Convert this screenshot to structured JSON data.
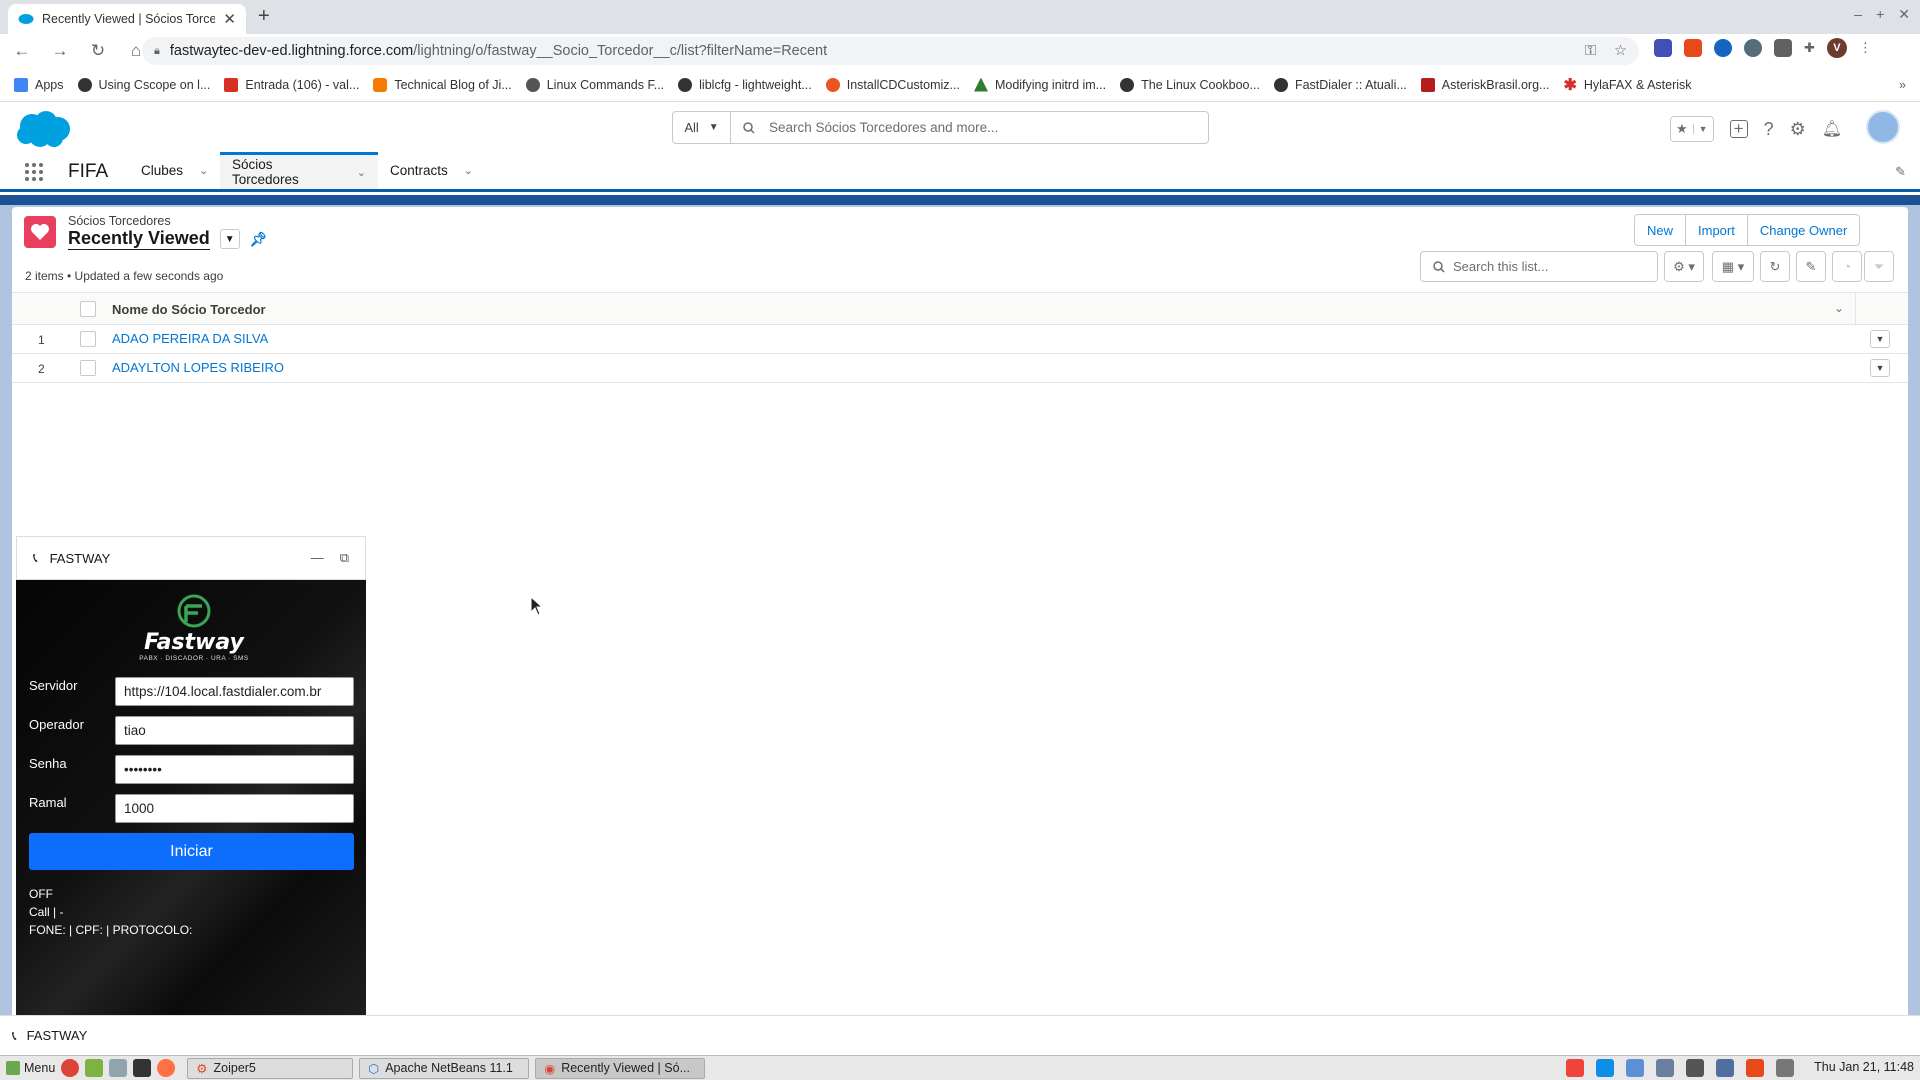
{
  "browser": {
    "tab_title": "Recently Viewed | Sócios Torce",
    "url_domain": "fastwaytec-dev-ed.lightning.force.com",
    "url_path": "/lightning/o/fastway__Socio_Torcedor__c/list?filterName=Recent",
    "bookmarks": [
      {
        "label": "Apps",
        "color": "#4285f4"
      },
      {
        "label": "Using Cscope on l...",
        "color": "#333"
      },
      {
        "label": "Entrada (106) - val...",
        "color": "#d93025"
      },
      {
        "label": "Technical Blog of Ji...",
        "color": "#f57c00"
      },
      {
        "label": "Linux Commands F...",
        "color": "#555"
      },
      {
        "label": "liblcfg - lightweight...",
        "color": "#333"
      },
      {
        "label": "InstallCDCustomiz...",
        "color": "#e95420"
      },
      {
        "label": "Modifying initrd im...",
        "color": "#2e7d32"
      },
      {
        "label": "The Linux Cookboo...",
        "color": "#333"
      },
      {
        "label": "FastDialer :: Atuali...",
        "color": "#333"
      },
      {
        "label": "AsteriskBrasil.org...",
        "color": "#b71c1c"
      },
      {
        "label": "HylaFAX & Asterisk",
        "color": "#d32f2f"
      }
    ]
  },
  "sf": {
    "search_scope": "All",
    "search_placeholder": "Search Sócios Torcedores and more...",
    "app_name": "FIFA",
    "nav": [
      {
        "label": "Clubes"
      },
      {
        "label": "Sócios Torcedores"
      },
      {
        "label": "Contracts"
      }
    ],
    "object_label": "Sócios Torcedores",
    "list_view": "Recently Viewed",
    "meta": "2 items • Updated a few seconds ago",
    "actions": [
      "New",
      "Import",
      "Change Owner"
    ],
    "list_search_placeholder": "Search this list...",
    "column_header": "Nome do Sócio Torcedor",
    "rows": [
      {
        "num": "1",
        "name": "ADAO PEREIRA DA SILVA"
      },
      {
        "num": "2",
        "name": "ADAYLTON LOPES RIBEIRO"
      }
    ]
  },
  "softphone": {
    "title": "FASTWAY",
    "logo_word": "Fastway",
    "logo_tag": "PABX · DISCADOR · URA · SMS",
    "fields": [
      {
        "label": "Servidor",
        "value": "https://104.local.fastdialer.com.br"
      },
      {
        "label": "Operador",
        "value": "tiao"
      },
      {
        "label": "Senha",
        "value": "••••••••"
      },
      {
        "label": "Ramal",
        "value": "1000"
      }
    ],
    "button": "Iniciar",
    "status_lines": [
      "OFF",
      "Call | -",
      "FONE: | CPF: | PROTOCOLO:"
    ]
  },
  "utility": {
    "label": "FASTWAY"
  },
  "taskbar": {
    "menu": "Menu",
    "items": [
      "Zoiper5",
      "Apache NetBeans 11.1",
      "Recently Viewed | Só..."
    ],
    "clock": "Thu Jan 21, 11:48"
  }
}
